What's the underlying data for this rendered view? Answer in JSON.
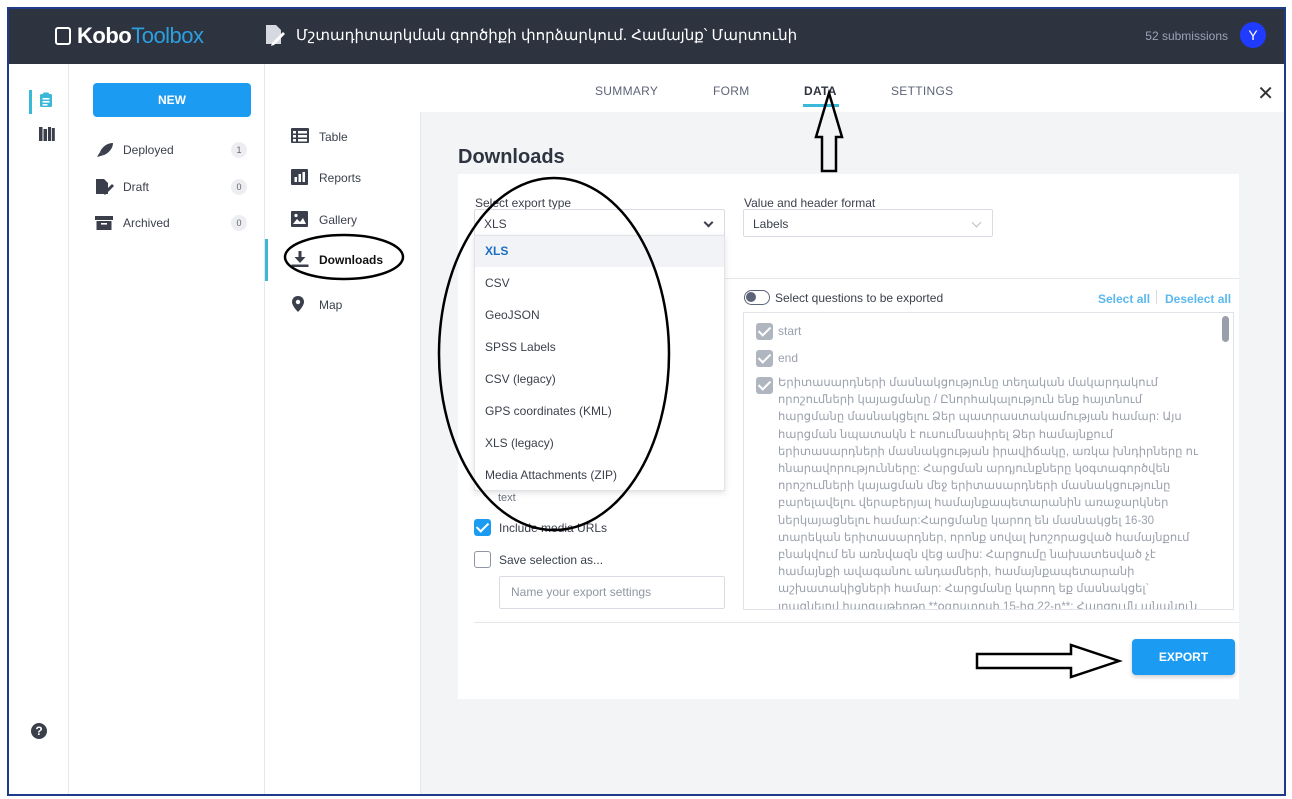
{
  "header": {
    "logo_prefix": "Kobo",
    "logo_suffix": "Toolbox",
    "asset_title": "Մշտադիտարկման գործիքի փորձարկում. Համայնք՝ Մարտունի",
    "submissions": "52 submissions",
    "avatar_initial": "Y",
    "accent_color": "#1f3bff"
  },
  "projects": {
    "new_button": "NEW",
    "items": [
      {
        "label": "Deployed",
        "count": "1",
        "icon": "rocket-icon"
      },
      {
        "label": "Draft",
        "count": "0",
        "icon": "draft-icon"
      },
      {
        "label": "Archived",
        "count": "0",
        "icon": "archive-icon"
      }
    ]
  },
  "tabs": [
    {
      "label": "SUMMARY"
    },
    {
      "label": "FORM"
    },
    {
      "label": "DATA",
      "active": true
    },
    {
      "label": "SETTINGS"
    }
  ],
  "subnav": [
    {
      "label": "Table",
      "icon": "table-icon"
    },
    {
      "label": "Reports",
      "icon": "reports-icon"
    },
    {
      "label": "Gallery",
      "icon": "gallery-icon"
    },
    {
      "label": "Downloads",
      "icon": "download-icon",
      "active": true
    },
    {
      "label": "Map",
      "icon": "map-pin-icon"
    }
  ],
  "downloads": {
    "title": "Downloads",
    "export_type_label": "Select export type",
    "export_type_value": "XLS",
    "export_options": [
      "XLS",
      "CSV",
      "GeoJSON",
      "SPSS Labels",
      "CSV (legacy)",
      "GPS coordinates (KML)",
      "XLS (legacy)",
      "Media Attachments (ZIP)"
    ],
    "format_label": "Value and header format",
    "format_value": "Labels",
    "partial_text": "text",
    "include_media_label": "Include media URLs",
    "save_selection_label": "Save selection as...",
    "name_placeholder": "Name your export settings",
    "select_questions_label": "Select questions to be exported",
    "select_all": "Select all",
    "deselect_all": "Deselect all",
    "questions": [
      "start",
      "end"
    ],
    "question_long": "Երիտասարդների մասնակցությունը տեղական մակարդակում որոշումների կայացմանը / Ընորհակալություն ենք հայտնում հարցմանը մասնակցելու Ձեր պատրաստակամության համար: Այս հարցման նպատակն է ուսումնասիրել Ձեր համայնքում երիտասարդների մասնակցության իրավիճակը, առկա խնդիրները ու հնարավորությունները: Հարցման արդյունքները կօգտագործվեն որոշումների կայացման մեջ երիտասարդների մասնակցությունը բարելավելու վերաբերյալ համայնքապետարանին առաջարկներ ներկայացնելու համար:Հարցմանը կարող են մասնակցել 16-30 տարեկան երիտասարդներ, որոնք սովալ խոշորացված համայնքում բնակվում են առնվազն վեց ամիս: Հարցումը նախատեսված չէ համայնքի ավագանու անդամների, համայնքապետարանի աշխատակիցների համար: Հարցմանը կարող եք մասնակցել` լրացնելով հարցաթերթը **օգոստոսի 15-ից 22-ը**: Հարցումն անանուն է՝ բոլոր",
    "export_button": "EXPORT"
  }
}
